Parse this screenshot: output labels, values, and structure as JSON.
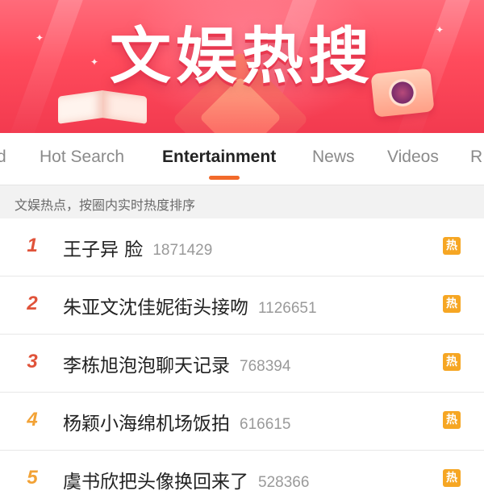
{
  "banner": {
    "title": "文娱热搜"
  },
  "tabs": [
    {
      "label": "d",
      "active": false
    },
    {
      "label": "Hot Search",
      "active": false
    },
    {
      "label": "Entertainment",
      "active": true
    },
    {
      "label": "News",
      "active": false
    },
    {
      "label": "Videos",
      "active": false
    },
    {
      "label": "R",
      "active": false
    }
  ],
  "subheader": {
    "text": "文娱热点，按圈内实时热度排序"
  },
  "list": {
    "items": [
      {
        "rank": "1",
        "title": "王子异 脸",
        "count": "1871429",
        "badge": "热",
        "rank_color": "#e0533a"
      },
      {
        "rank": "2",
        "title": "朱亚文沈佳妮街头接吻",
        "count": "1126651",
        "badge": "热",
        "rank_color": "#e0533a"
      },
      {
        "rank": "3",
        "title": "李栋旭泡泡聊天记录",
        "count": "768394",
        "badge": "热",
        "rank_color": "#e0533a"
      },
      {
        "rank": "4",
        "title": "杨颖小海绵机场饭拍",
        "count": "616615",
        "badge": "热",
        "rank_color": "#f2a236"
      },
      {
        "rank": "5",
        "title": "虞书欣把头像换回来了",
        "count": "528366",
        "badge": "热",
        "rank_color": "#f2a236"
      }
    ]
  },
  "colors": {
    "accent": "#f26a2b",
    "badge": "#f6a623",
    "banner": "#ff4b5c"
  }
}
